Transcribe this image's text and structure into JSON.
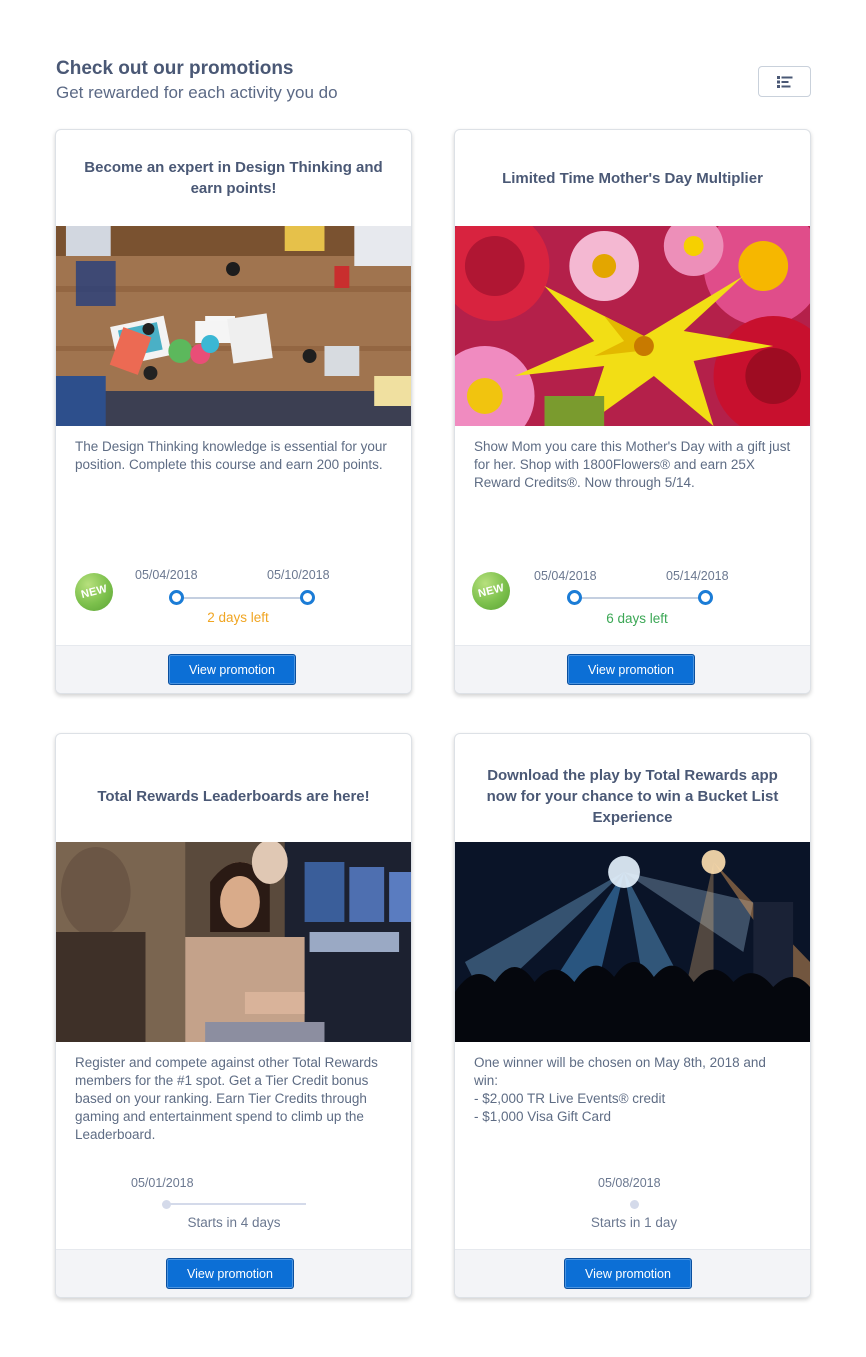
{
  "header": {
    "title": "Check out our promotions",
    "subtitle": "Get rewarded for each activity you do"
  },
  "toolbar": {
    "view_toggle_icon": "list-view-icon"
  },
  "promotions": [
    {
      "title": "Become an expert in Design Thinking and earn points!",
      "image_icon": "design-thinking-photo",
      "description": "The Design Thinking knowledge is essential for your position. Complete this course and earn 200 points.",
      "badge": "NEW",
      "start_date": "05/04/2018",
      "end_date": "05/10/2018",
      "status": "2 days left",
      "status_color": "#f0a522",
      "button": "View promotion"
    },
    {
      "title": "Limited Time Mother's Day Multiplier",
      "image_icon": "flowers-photo",
      "description": "Show Mom you care this Mother's Day with a gift just for her. Shop with 1800Flowers® and earn 25X Reward Credits®. Now through 5/14.",
      "badge": "NEW",
      "start_date": "05/04/2018",
      "end_date": "05/14/2018",
      "status": "6 days left",
      "status_color": "#3ba755",
      "button": "View promotion"
    },
    {
      "title": "Total Rewards Leaderboards are here!",
      "image_icon": "casino-players-photo",
      "description": "Register and compete against other Total Rewards members for the #1 spot. Get a Tier Credit bonus based on your ranking. Earn Tier Credits through gaming and entertainment spend to climb up the Leaderboard.",
      "start_date": "05/01/2018",
      "status": "Starts in 4 days",
      "status_color": "#6b7890",
      "button": "View promotion"
    },
    {
      "title": "Download the play by Total Rewards app now for your chance to win a Bucket List Experience",
      "image_icon": "concert-crowd-photo",
      "description": "One winner will be chosen on May 8th, 2018 and win:\n- $2,000 TR Live Events® credit\n- $1,000 Visa Gift Card",
      "start_date": "05/08/2018",
      "status": "Starts in 1 day",
      "status_color": "#6b7890",
      "button": "View promotion"
    }
  ]
}
